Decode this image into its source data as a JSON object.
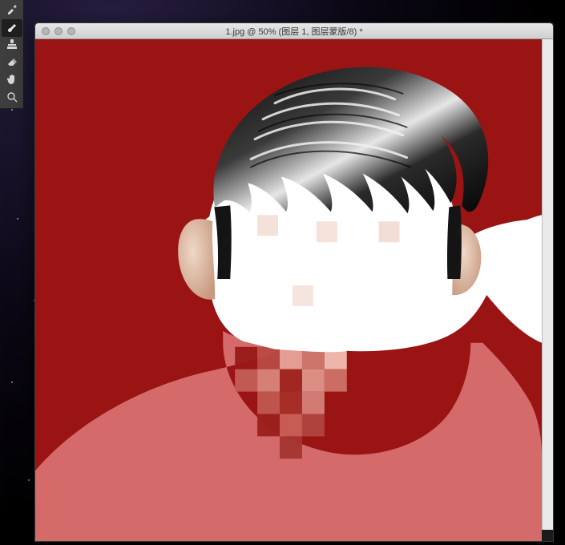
{
  "window": {
    "title": "1.jpg @ 50% (图层 1, 图层蒙版/8) *"
  },
  "toolbox": {
    "tools": [
      {
        "name": "eyedropper-tool",
        "icon": "eyedropper-icon",
        "selected": false
      },
      {
        "name": "brush-tool",
        "icon": "brush-icon",
        "selected": true
      },
      {
        "name": "clone-stamp-tool",
        "icon": "stamp-icon",
        "selected": false
      },
      {
        "name": "eraser-tool",
        "icon": "eraser-icon",
        "selected": false
      },
      {
        "name": "hand-tool",
        "icon": "hand-icon",
        "selected": false
      },
      {
        "name": "zoom-tool",
        "icon": "zoom-icon",
        "selected": false
      }
    ]
  },
  "canvas": {
    "background_color": "#9a1414",
    "mask_fill_color": "#ffffff",
    "shirt_tint_color": "#d46a6a"
  }
}
